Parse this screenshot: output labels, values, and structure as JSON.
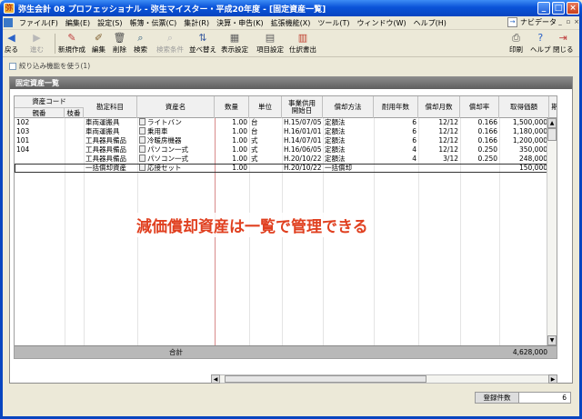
{
  "window": {
    "title": "弥生会計 08 プロフェッショナル - 弥生マイスター・平成20年度 - [固定資産一覧]",
    "min": "_",
    "max": "□",
    "close": "×"
  },
  "menu": [
    "ファイル(F)",
    "編集(E)",
    "設定(S)",
    "帳簿・伝票(C)",
    "集計(R)",
    "決算・申告(K)",
    "拡張機能(X)",
    "ツール(T)",
    "ウィンドウ(W)",
    "ヘルプ(H)"
  ],
  "navi_label": "ナビデータ",
  "toolbar": {
    "back": "戻る",
    "forward": "進む",
    "new": "新規作成",
    "edit": "編集",
    "delete": "削除",
    "search": "検索",
    "find_condition": "検索条件",
    "sort": "並べ替え",
    "display_settings": "表示設定",
    "item_settings": "項目設定",
    "journal_output": "仕訳書出",
    "print": "印刷",
    "help": "ヘルプ",
    "close": "閉じる"
  },
  "filter_label": "絞り込み機能を使う(1)",
  "panel_title": "固定資産一覧",
  "headers": {
    "asset_code": "資産コード",
    "parent": "親番",
    "branch": "枝番",
    "account": "勘定科目",
    "asset_name": "資産名",
    "quantity": "数量",
    "unit": "単位",
    "service_date": "事業供用開始日",
    "method": "償却方法",
    "years": "耐用年数",
    "months": "償却月数",
    "rate": "償却率",
    "cost": "取得価額",
    "extra": "期"
  },
  "rows": [
    {
      "code": "102",
      "branch": "",
      "account": "車両運搬具",
      "name": "ライトバン",
      "qty": "1.00",
      "unit": "台",
      "date": "H.15/07/05",
      "method": "定額法",
      "years": "6",
      "months": "12/12",
      "rate": "0.166",
      "cost": "1,500,000"
    },
    {
      "code": "103",
      "branch": "",
      "account": "車両運搬具",
      "name": "乗用車",
      "qty": "1.00",
      "unit": "台",
      "date": "H.16/01/01",
      "method": "定額法",
      "years": "6",
      "months": "12/12",
      "rate": "0.166",
      "cost": "1,180,000"
    },
    {
      "code": "101",
      "branch": "",
      "account": "工具器具備品",
      "name": "冷暖房機器",
      "qty": "1.00",
      "unit": "式",
      "date": "H.14/07/01",
      "method": "定額法",
      "years": "6",
      "months": "12/12",
      "rate": "0.166",
      "cost": "1,200,000"
    },
    {
      "code": "104",
      "branch": "",
      "account": "工具器具備品",
      "name": "パソコン一式",
      "qty": "1.00",
      "unit": "式",
      "date": "H.16/06/05",
      "method": "定額法",
      "years": "4",
      "months": "12/12",
      "rate": "0.250",
      "cost": "350,000"
    },
    {
      "code": "",
      "branch": "",
      "account": "工具器具備品",
      "name": "パソコン一式",
      "qty": "1.00",
      "unit": "式",
      "date": "H.20/10/22",
      "method": "定額法",
      "years": "4",
      "months": "3/12",
      "rate": "0.250",
      "cost": "248,000"
    },
    {
      "code": "",
      "branch": "",
      "account": "一括償却資産",
      "name": "応接セット",
      "qty": "1.00",
      "unit": "",
      "date": "H.20/10/22",
      "method": "一括償却",
      "years": "",
      "months": "",
      "rate": "",
      "cost": "150,000"
    }
  ],
  "total_label": "合計",
  "total_value": "4,628,000",
  "caption": "減価償却資産は一覧で管理できる",
  "footer": {
    "label": "登録件数",
    "value": "6"
  }
}
